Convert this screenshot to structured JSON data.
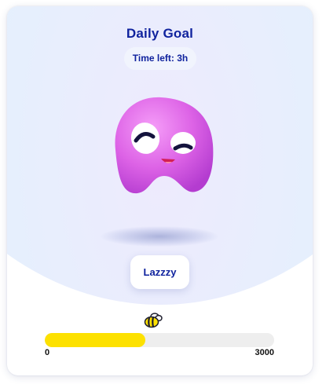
{
  "card": {
    "title": "Daily Goal",
    "time_left": "Time left: 3h",
    "mood_label": "Lazzzy",
    "progress": {
      "min_label": "0",
      "max_label": "3000",
      "fraction": 0.44,
      "fill_color": "#FDE100"
    },
    "mascot_icon": "pink-blob-character",
    "progress_icon": "bee-icon"
  }
}
